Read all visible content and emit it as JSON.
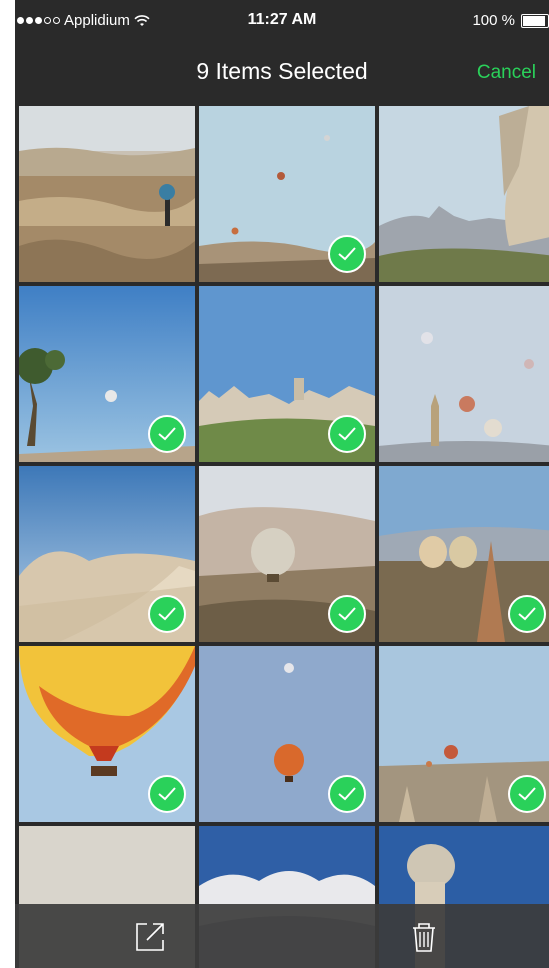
{
  "status_bar": {
    "carrier": "Applidium",
    "time": "11:27 AM",
    "battery": "100 %"
  },
  "nav": {
    "title": "9 Items Selected",
    "cancel_label": "Cancel"
  },
  "colors": {
    "accent": "#2ad15a",
    "background": "#2a2a2a"
  },
  "photos": [
    {
      "scene": "badlands-hiker",
      "selected": false
    },
    {
      "scene": "balloons-sky-small",
      "selected": true
    },
    {
      "scene": "rock-town",
      "selected": false
    },
    {
      "scene": "tree-balloon",
      "selected": true
    },
    {
      "scene": "rock-pillars",
      "selected": true
    },
    {
      "scene": "minaret-balloons",
      "selected": false
    },
    {
      "scene": "dirt-road",
      "selected": true
    },
    {
      "scene": "balloon-village",
      "selected": true
    },
    {
      "scene": "balloons-valley",
      "selected": true
    },
    {
      "scene": "big-balloon",
      "selected": true
    },
    {
      "scene": "single-balloon",
      "selected": true
    },
    {
      "scene": "balloons-far",
      "selected": true
    },
    {
      "scene": "haze",
      "selected": false
    },
    {
      "scene": "snow-hills",
      "selected": false
    },
    {
      "scene": "fairy-chimney",
      "selected": false
    }
  ],
  "toolbar": {
    "share_icon": "share-icon",
    "trash_icon": "trash-icon"
  }
}
